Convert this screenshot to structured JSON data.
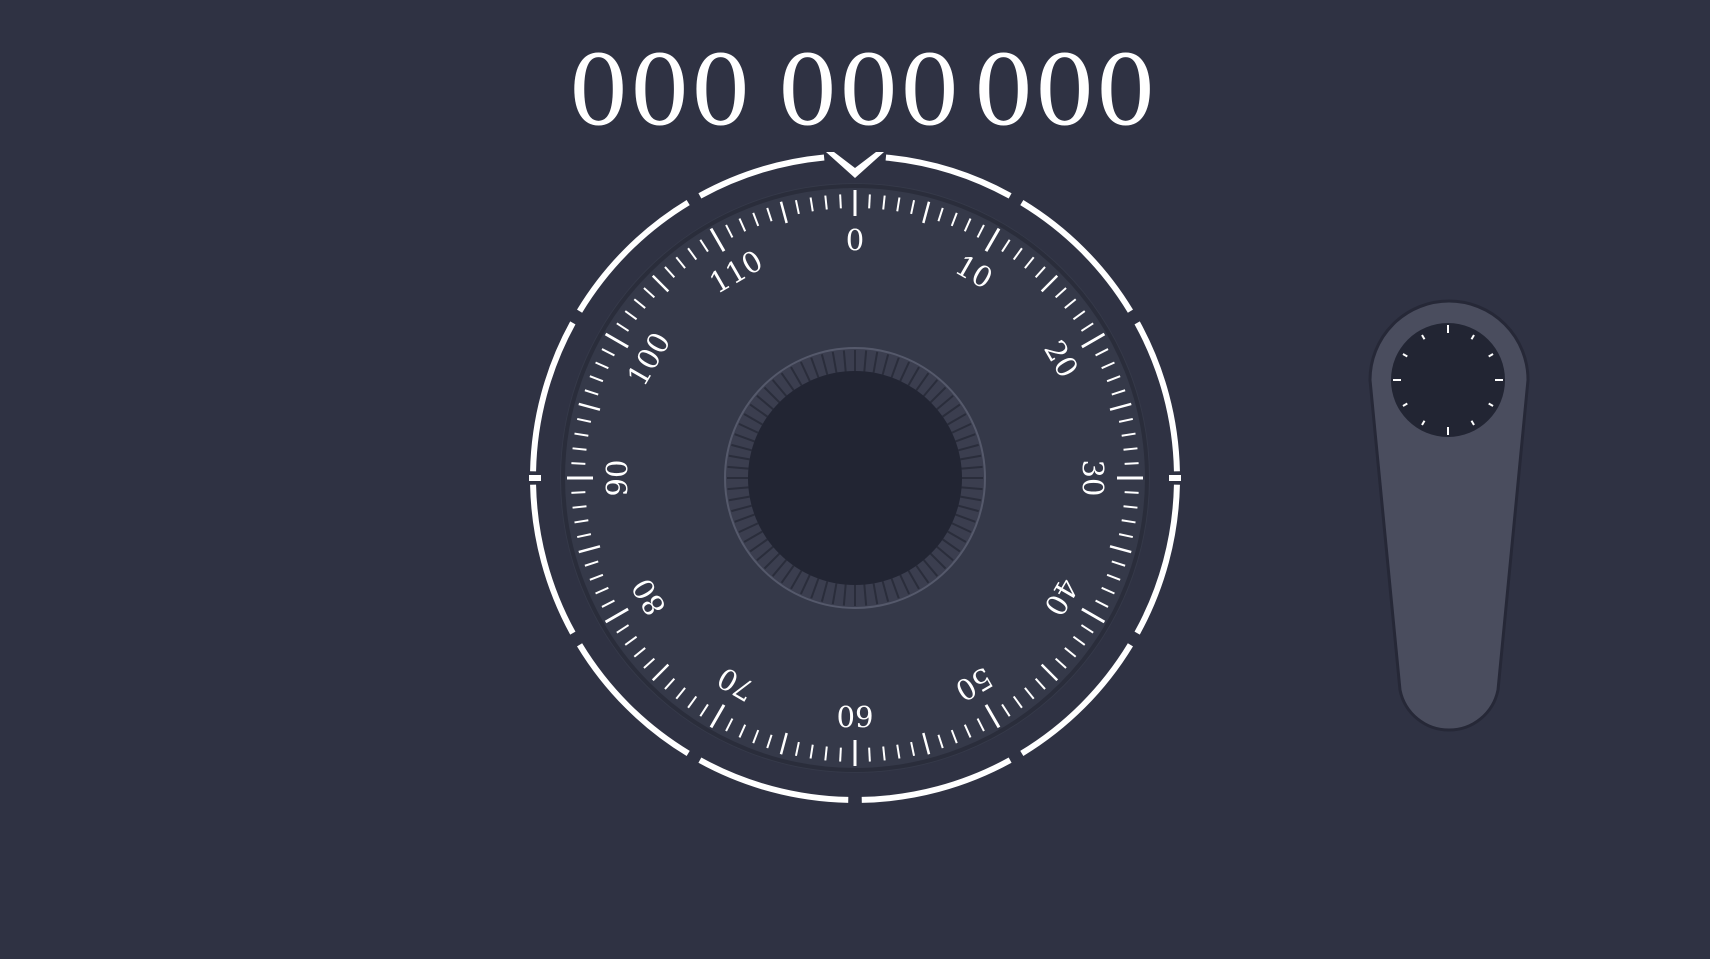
{
  "combination": [
    "000",
    "000",
    "000"
  ],
  "dial": {
    "labels": [
      "0",
      "10",
      "20",
      "30",
      "40",
      "50",
      "60",
      "70",
      "80",
      "90",
      "100",
      "110"
    ],
    "tick_count": 120,
    "current_value": 0
  },
  "handle": {
    "icon": "lever-handle-icon"
  },
  "colors": {
    "background": "#2f3243",
    "dial_face": "#353949",
    "knob": "#222533",
    "handle": "#4a4d5e",
    "accent": "#ffffff"
  }
}
